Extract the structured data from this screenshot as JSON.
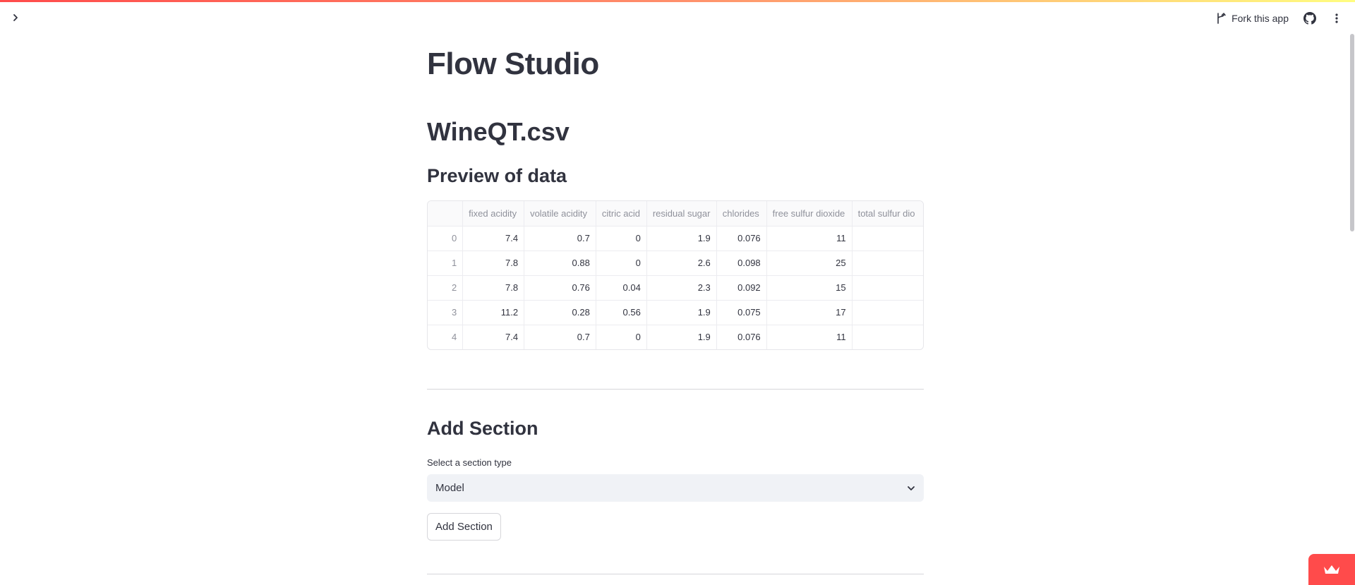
{
  "header": {
    "fork_label": "Fork this app",
    "icons": [
      "chevron-right-icon",
      "fork-icon",
      "github-icon",
      "more-vertical-icon"
    ]
  },
  "main": {
    "title": "Flow Studio",
    "file_name": "WineQT.csv",
    "preview_heading": "Preview of data",
    "table": {
      "columns": [
        "",
        "fixed acidity",
        "volatile acidity",
        "citric acid",
        "residual sugar",
        "chlorides",
        "free sulfur dioxide",
        "total sulfur dio"
      ],
      "rows": [
        [
          "0",
          "7.4",
          "0.7",
          "0",
          "1.9",
          "0.076",
          "11",
          ""
        ],
        [
          "1",
          "7.8",
          "0.88",
          "0",
          "2.6",
          "0.098",
          "25",
          ""
        ],
        [
          "2",
          "7.8",
          "0.76",
          "0.04",
          "2.3",
          "0.092",
          "15",
          ""
        ],
        [
          "3",
          "11.2",
          "0.28",
          "0.56",
          "1.9",
          "0.075",
          "17",
          ""
        ],
        [
          "4",
          "7.4",
          "0.7",
          "0",
          "1.9",
          "0.076",
          "11",
          ""
        ]
      ]
    },
    "add_section": {
      "heading": "Add Section",
      "select_label": "Select a section type",
      "select_value": "Model",
      "button_label": "Add Section"
    }
  },
  "colors": {
    "accent": "#ff4b4b",
    "text": "#31333f",
    "muted": "#8f919b",
    "select_bg": "#f0f2f6"
  }
}
